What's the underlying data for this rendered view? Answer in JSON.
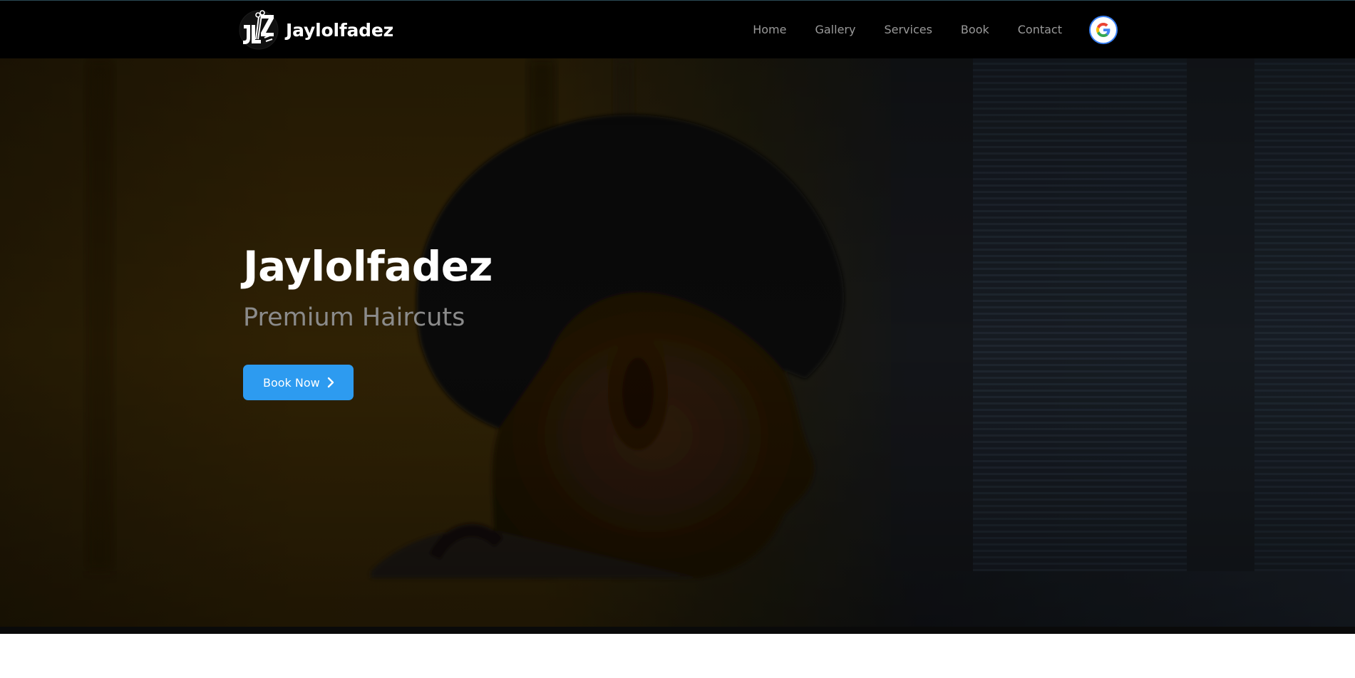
{
  "brand": {
    "logo_icon": "jlfz-scissors-logo",
    "logo_text": "JLFZ",
    "name": "Jaylolfadez"
  },
  "nav": {
    "items": [
      {
        "label": "Home"
      },
      {
        "label": "Gallery"
      },
      {
        "label": "Services"
      },
      {
        "label": "Book"
      },
      {
        "label": "Contact"
      }
    ],
    "google_icon": "google-icon"
  },
  "hero": {
    "title": "Jaylolfadez",
    "subtitle": "Premium Haircuts",
    "cta_label": "Book Now",
    "cta_icon": "chevron-right-icon"
  },
  "colors": {
    "navbar_bg": "#000000",
    "accent": "#2d9bf0",
    "nav_text": "#9a9a9a",
    "google_ring": "#3b82f6"
  }
}
